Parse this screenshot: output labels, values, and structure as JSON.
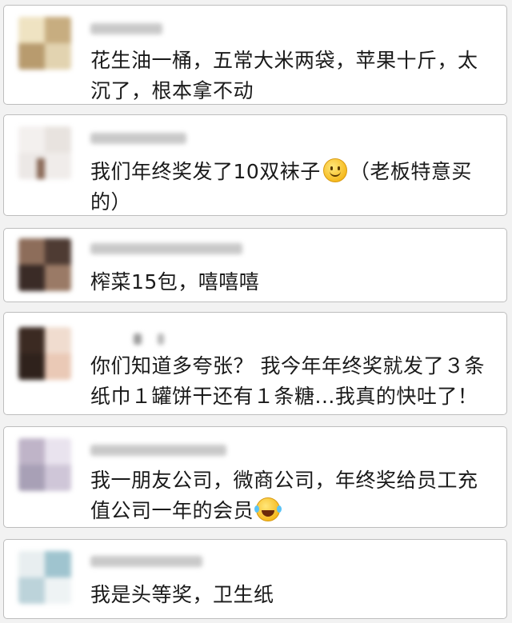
{
  "comments": [
    {
      "text": "花生油一桶，五常大米两袋，苹果十斤，太沉了，根本拿不动",
      "emoji": "",
      "tail": ""
    },
    {
      "text": "我们年终奖发了10双袜子",
      "emoji": "smile-emoji",
      "tail": "（老板特意买的）"
    },
    {
      "text": "榨菜15包，嘻嘻嘻",
      "emoji": "",
      "tail": ""
    },
    {
      "text": "你们知道多夸张？ 我今年年终奖就发了３条纸巾１罐饼干还有１条糖...我真的快吐了！",
      "emoji": "",
      "tail": ""
    },
    {
      "text": "我一朋友公司，微商公司，年终奖给员工充值公司一年的会员",
      "emoji": "laughing-tears-emoji",
      "tail": ""
    },
    {
      "text": "我是头等奖，卫生纸",
      "emoji": "",
      "tail": ""
    }
  ],
  "colors": {
    "background": "#f2f2f2",
    "card": "#ffffff",
    "border": "#bdbdbd",
    "text": "#1a1a1a"
  }
}
